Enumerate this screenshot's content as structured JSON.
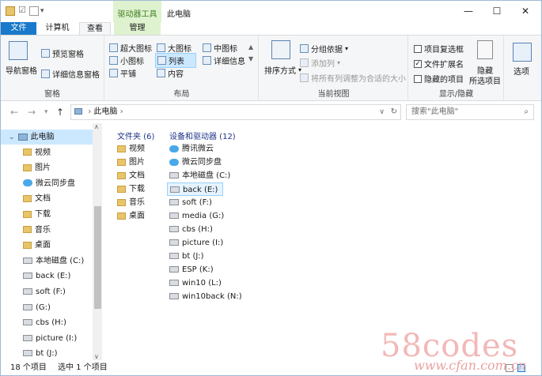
{
  "window": {
    "title": "此电脑",
    "context_tab": "驱动器工具",
    "minimize": "—",
    "maximize": "☐",
    "close": "✕"
  },
  "tabs": {
    "file": "文件",
    "computer": "计算机",
    "view": "查看",
    "manage": "管理"
  },
  "ribbon": {
    "panes": {
      "nav_pane": "导航窗格",
      "preview": "预览窗格",
      "details": "详细信息窗格",
      "label": "窗格"
    },
    "layout": {
      "xl_icons": "超大图标",
      "large_icons": "大图标",
      "medium_icons": "中图标",
      "small_icons": "小图标",
      "list": "列表",
      "details": "详细信息",
      "tiles": "平铺",
      "content": "内容",
      "label": "布局"
    },
    "current_view": {
      "sort": "排序方式",
      "group_by": "分组依据",
      "add_column": "添加列",
      "fit_columns": "将所有列调整为合适的大小",
      "label": "当前视图"
    },
    "show_hide": {
      "item_checkboxes": "项目复选框",
      "file_ext": "文件扩展名",
      "hidden_items": "隐藏的项目",
      "hide": "隐藏",
      "selected_items": "所选项目",
      "options": "选项",
      "label": "显示/隐藏",
      "file_ext_checked": true
    }
  },
  "address": {
    "path": "此电脑",
    "search_placeholder": "搜索\"此电脑\""
  },
  "nav_pane": {
    "items": [
      {
        "label": "此电脑",
        "type": "pc"
      },
      {
        "label": "视频",
        "type": "folder"
      },
      {
        "label": "图片",
        "type": "folder"
      },
      {
        "label": "微云同步盘",
        "type": "cloud"
      },
      {
        "label": "文档",
        "type": "folder"
      },
      {
        "label": "下载",
        "type": "folder"
      },
      {
        "label": "音乐",
        "type": "folder"
      },
      {
        "label": "桌面",
        "type": "folder"
      },
      {
        "label": "本地磁盘 (C:)",
        "type": "drive"
      },
      {
        "label": "back (E:)",
        "type": "drive"
      },
      {
        "label": "soft (F:)",
        "type": "drive"
      },
      {
        "label": "(G:)",
        "type": "drive"
      },
      {
        "label": "cbs (H:)",
        "type": "drive"
      },
      {
        "label": "picture (I:)",
        "type": "drive"
      },
      {
        "label": "bt (J:)",
        "type": "drive"
      }
    ]
  },
  "folders": {
    "header": "文件夹 (6)",
    "items": [
      "视频",
      "图片",
      "文档",
      "下载",
      "音乐",
      "桌面"
    ]
  },
  "devices": {
    "header": "设备和驱动器 (12)",
    "items": [
      "腾讯微云",
      "微云同步盘",
      "本地磁盘 (C:)",
      "back (E:)",
      "soft (F:)",
      "media (G:)",
      "cbs (H:)",
      "picture (I:)",
      "bt (J:)",
      "ESP (K:)",
      "win10 (L:)",
      "win10back (N:)"
    ]
  },
  "status": {
    "count": "18 个项目",
    "selected": "选中 1 个项目"
  },
  "watermark": {
    "main": "58codes",
    "sub": "www.cfan.com.cn"
  },
  "colors": {
    "accent": "#1979ca",
    "context_tab_bg": "#dff2cf",
    "selection": "#cce8ff"
  }
}
